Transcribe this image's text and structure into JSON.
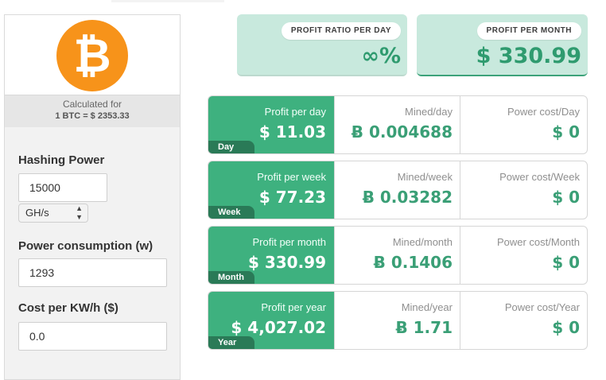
{
  "coin": {
    "logo_symbol": "₿",
    "calculated_for_label": "Calculated for",
    "rate_text": "1 BTC = $ 2353.33"
  },
  "form": {
    "hashing_power": {
      "label": "Hashing Power",
      "value": "15000",
      "unit": "GH/s"
    },
    "power_consumption": {
      "label": "Power consumption (w)",
      "value": "1293"
    },
    "cost_per_kwh": {
      "label": "Cost per KW/h ($)",
      "value": "0.0"
    }
  },
  "summary": {
    "profit_ratio": {
      "label": "PROFIT RATIO PER DAY",
      "value": "∞%"
    },
    "profit_month": {
      "label": "PROFIT PER MONTH",
      "value": "$ 330.99"
    }
  },
  "rows": [
    {
      "tag": "Day",
      "profit_label": "Profit per day",
      "profit_value": "$ 11.03",
      "mined_label": "Mined/day",
      "mined_value": "Ƀ 0.004688",
      "power_label": "Power cost/Day",
      "power_value": "$ 0"
    },
    {
      "tag": "Week",
      "profit_label": "Profit per week",
      "profit_value": "$ 77.23",
      "mined_label": "Mined/week",
      "mined_value": "Ƀ 0.03282",
      "power_label": "Power cost/Week",
      "power_value": "$ 0"
    },
    {
      "tag": "Month",
      "profit_label": "Profit per month",
      "profit_value": "$ 330.99",
      "mined_label": "Mined/month",
      "mined_value": "Ƀ 0.1406",
      "power_label": "Power cost/Month",
      "power_value": "$ 0"
    },
    {
      "tag": "Year",
      "profit_label": "Profit per year",
      "profit_value": "$ 4,027.02",
      "mined_label": "Mined/year",
      "mined_value": "Ƀ 1.71",
      "power_label": "Power cost/Year",
      "power_value": "$ 0"
    }
  ],
  "colors": {
    "accent_green": "#3eb17f",
    "dark_green": "#2a7a57",
    "light_green": "#c8e9dd",
    "bitcoin_orange": "#f7931a"
  },
  "icons": {
    "logo": "bitcoin-logo-icon",
    "select_arrows": "select-arrows-icon"
  }
}
